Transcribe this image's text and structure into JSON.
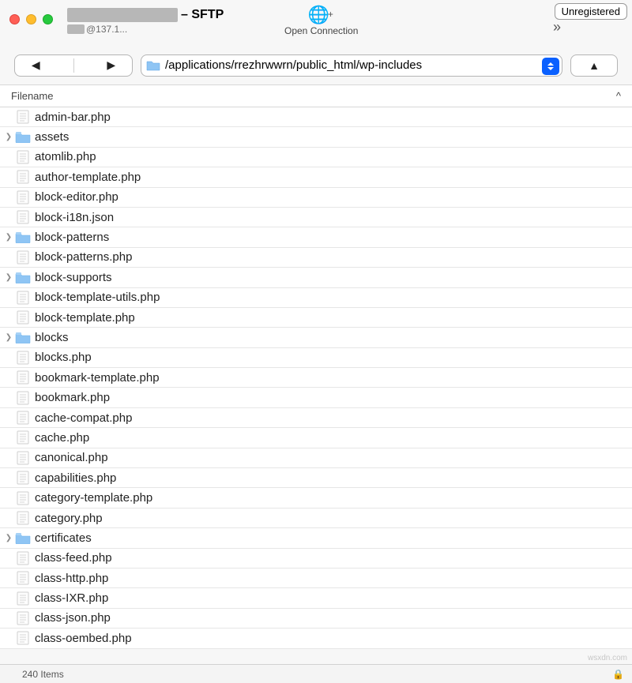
{
  "window": {
    "title_suffix": "– SFTP",
    "host_suffix": "@137.1...",
    "unregistered_label": "Unregistered"
  },
  "toolbar": {
    "open_connection_label": "Open Connection"
  },
  "path": {
    "value": "/applications/rrezhrwwrn/public_html/wp-includes"
  },
  "columns": {
    "filename": "Filename"
  },
  "status": {
    "item_count": "240 Items"
  },
  "watermark": "wsxdn.com",
  "files": [
    {
      "name": "admin-bar.php",
      "type": "file",
      "expandable": false
    },
    {
      "name": "assets",
      "type": "folder",
      "expandable": true
    },
    {
      "name": "atomlib.php",
      "type": "file",
      "expandable": false
    },
    {
      "name": "author-template.php",
      "type": "file",
      "expandable": false
    },
    {
      "name": "block-editor.php",
      "type": "file",
      "expandable": false
    },
    {
      "name": "block-i18n.json",
      "type": "file",
      "expandable": false
    },
    {
      "name": "block-patterns",
      "type": "folder",
      "expandable": true
    },
    {
      "name": "block-patterns.php",
      "type": "file",
      "expandable": false
    },
    {
      "name": "block-supports",
      "type": "folder",
      "expandable": true
    },
    {
      "name": "block-template-utils.php",
      "type": "file",
      "expandable": false
    },
    {
      "name": "block-template.php",
      "type": "file",
      "expandable": false
    },
    {
      "name": "blocks",
      "type": "folder",
      "expandable": true
    },
    {
      "name": "blocks.php",
      "type": "file",
      "expandable": false
    },
    {
      "name": "bookmark-template.php",
      "type": "file",
      "expandable": false
    },
    {
      "name": "bookmark.php",
      "type": "file",
      "expandable": false
    },
    {
      "name": "cache-compat.php",
      "type": "file",
      "expandable": false
    },
    {
      "name": "cache.php",
      "type": "file",
      "expandable": false
    },
    {
      "name": "canonical.php",
      "type": "file",
      "expandable": false
    },
    {
      "name": "capabilities.php",
      "type": "file",
      "expandable": false
    },
    {
      "name": "category-template.php",
      "type": "file",
      "expandable": false
    },
    {
      "name": "category.php",
      "type": "file",
      "expandable": false
    },
    {
      "name": "certificates",
      "type": "folder",
      "expandable": true
    },
    {
      "name": "class-feed.php",
      "type": "file",
      "expandable": false
    },
    {
      "name": "class-http.php",
      "type": "file",
      "expandable": false
    },
    {
      "name": "class-IXR.php",
      "type": "file",
      "expandable": false
    },
    {
      "name": "class-json.php",
      "type": "file",
      "expandable": false
    },
    {
      "name": "class-oembed.php",
      "type": "file",
      "expandable": false
    }
  ]
}
